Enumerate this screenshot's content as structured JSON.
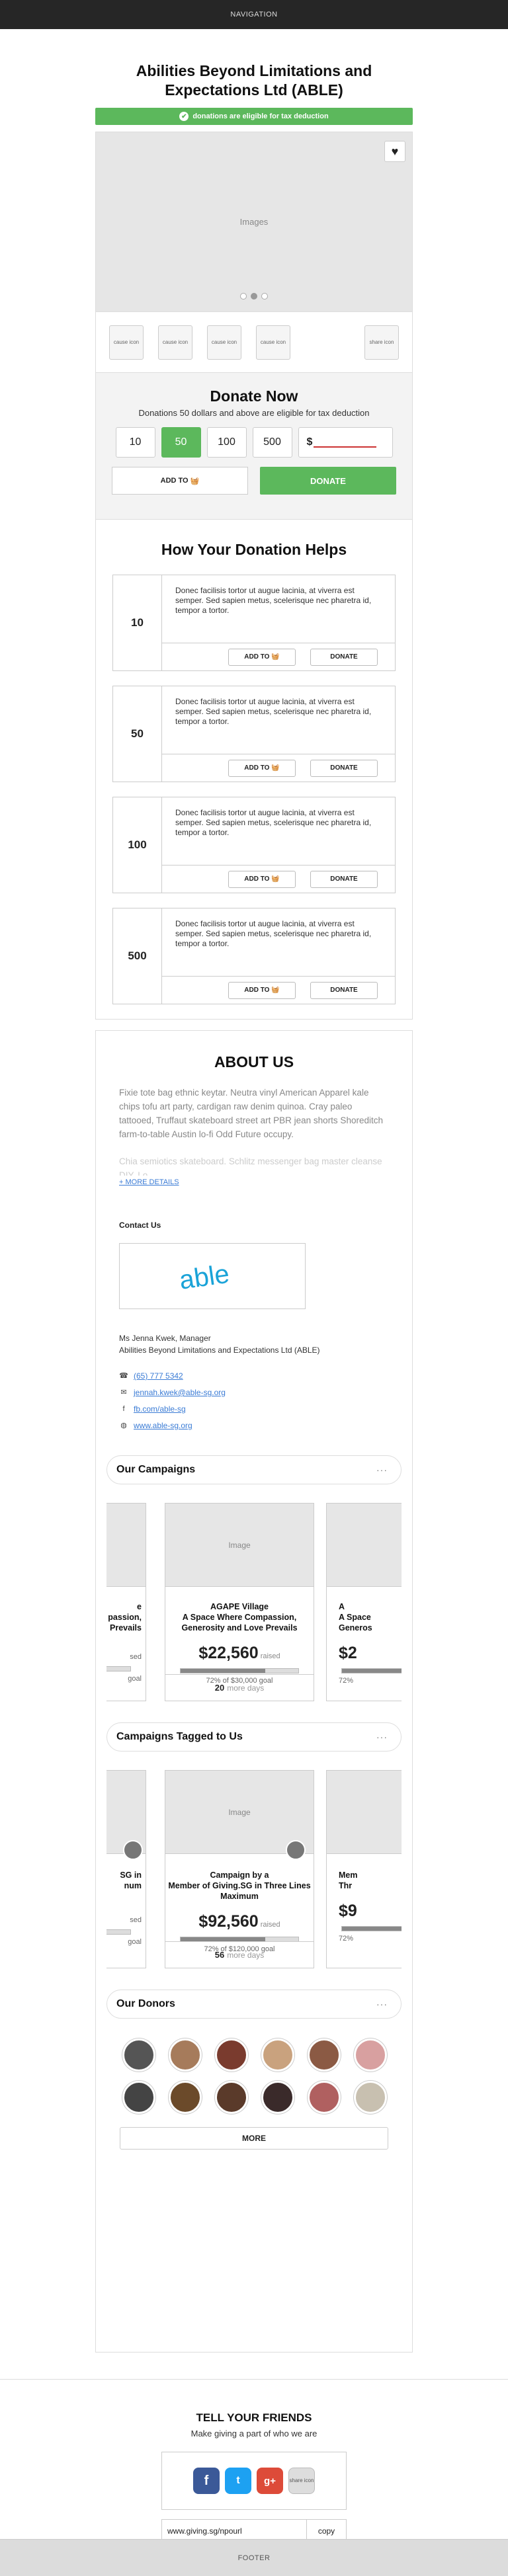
{
  "nav": {
    "label": "NAVIGATION"
  },
  "org": {
    "title": "Abilities Beyond Limitations and Expectations Ltd (ABLE)"
  },
  "tax_bar": {
    "text": "donations are eligible for tax deduction"
  },
  "gallery": {
    "image_label": "Images",
    "dots": 3,
    "active_dot": 1
  },
  "causes": {
    "icon_label": "cause icon",
    "share_label": "share icon"
  },
  "donate_now": {
    "title": "Donate Now",
    "subtitle": "Donations 50 dollars and above are eligible for tax deduction",
    "amounts": [
      "10",
      "50",
      "100",
      "500"
    ],
    "selected_amount": "50",
    "currency_prefix": "$",
    "add_to_label": "ADD TO",
    "donate_label": "DONATE"
  },
  "helps": {
    "title": "How Your Donation Helps",
    "items": [
      {
        "amount": "10",
        "text": "Donec facilisis tortor ut augue lacinia, at viverra est semper. Sed sapien metus, scelerisque nec pharetra id, tempor a tortor."
      },
      {
        "amount": "50",
        "text": "Donec facilisis tortor ut augue lacinia, at viverra est semper. Sed sapien metus, scelerisque nec pharetra id, tempor a tortor."
      },
      {
        "amount": "100",
        "text": "Donec facilisis tortor ut augue lacinia, at viverra est semper. Sed sapien metus, scelerisque nec pharetra id, tempor a tortor."
      },
      {
        "amount": "500",
        "text": "Donec facilisis tortor ut augue lacinia, at viverra est semper. Sed sapien metus, scelerisque nec pharetra id, tempor a tortor."
      }
    ],
    "add_to_label": "ADD TO",
    "donate_label": "DONATE"
  },
  "about": {
    "title": "ABOUT US",
    "paragraph": "Fixie tote bag ethnic keytar. Neutra vinyl American Apparel kale chips tofu art party, cardigan raw denim quinoa. Cray paleo tattooed, Truffaut skateboard street art PBR jean shorts Shoreditch farm-to-table Austin lo-fi Odd Future occupy.",
    "paragraph_faded": "Chia semiotics skateboard. Schlitz messenger bag master cleanse DIY. Lo",
    "more_label": "+ MORE DETAILS",
    "contact_heading": "Contact Us",
    "logo_text": "able",
    "person_name": "Ms Jenna Kwek, Manager",
    "person_org": "Abilities Beyond Limitations and Expectations Ltd (ABLE)",
    "phone": "(65) 777 5342",
    "email": "jennah.kwek@able-sg.org",
    "facebook": "fb.com/able-sg",
    "website": "www.able-sg.org"
  },
  "campaigns": {
    "title": "Our Campaigns",
    "menu": "···",
    "card": {
      "image_label": "Image",
      "title_1": "AGAPE Village",
      "title_2": "A Space Where Compassion, Generosity and Love Prevails",
      "raised": "$22,560",
      "raised_label": "raised",
      "progress": 0.72,
      "goal_text": "72% of $30,000 goal",
      "days": "20",
      "days_label": "more days"
    },
    "left_card": {
      "t1": "e",
      "t2": "passion,",
      "t3": "Prevails",
      "raised_label": "sed",
      "goal": "goal"
    },
    "right_card": {
      "t1": "A",
      "t2": "A Space",
      "t3": "Generos",
      "raised": "$2",
      "goal": "72%"
    }
  },
  "tagged": {
    "title": "Campaigns Tagged to Us",
    "menu": "···",
    "card": {
      "image_label": "Image",
      "title_1": "Campaign by a",
      "title_2": "Member of Giving.SG in Three Lines Maximum",
      "raised": "$92,560",
      "raised_label": "raised",
      "progress": 0.72,
      "goal_text": "72% of $120,000 goal",
      "days": "56",
      "days_label": "more days"
    },
    "left_card": {
      "t1": "SG in",
      "t2": "num",
      "raised_label": "sed",
      "goal": "goal"
    },
    "right_card": {
      "t1": "Mem",
      "t2": "Thr",
      "raised": "$9",
      "goal": "72%"
    }
  },
  "donors": {
    "title": "Our Donors",
    "menu": "···",
    "count": 12,
    "more_label": "MORE"
  },
  "tell": {
    "title": "TELL YOUR FRIENDS",
    "subtitle": "Make giving a part of who we are",
    "share_label": "share icon",
    "url": "www.giving.sg/npourl",
    "copy_label": "copy"
  },
  "footer": {
    "label": "FOOTER"
  },
  "colors": {
    "accent": "#5cb85c",
    "link": "#3a7bd5",
    "nav": "#262626"
  }
}
